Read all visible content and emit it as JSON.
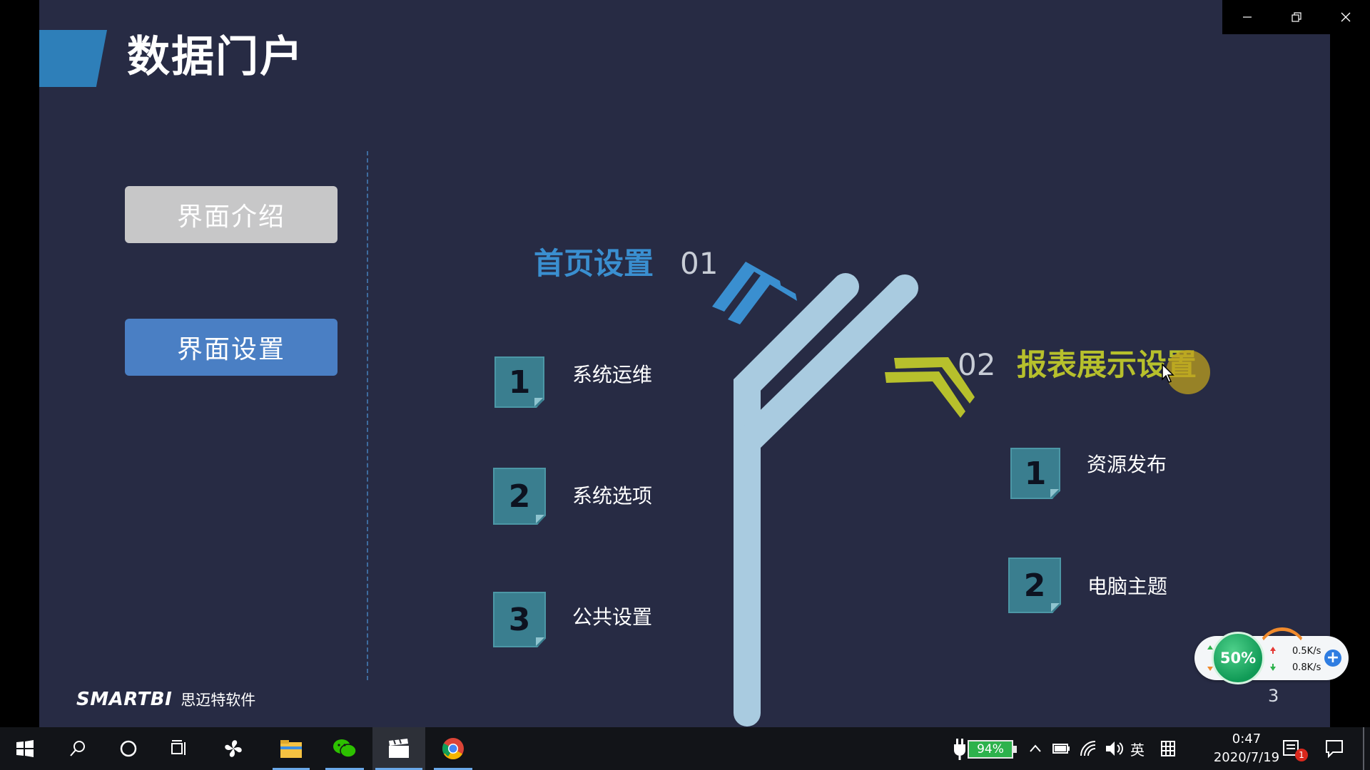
{
  "slide": {
    "title": "数据门户",
    "left_buttons": {
      "intro": "界面介绍",
      "settings": "界面设置"
    },
    "branch1": {
      "title": "首页设置",
      "number": "01",
      "color": "#3a8fd0",
      "items": [
        {
          "num": "1",
          "label": "系统运维"
        },
        {
          "num": "2",
          "label": "系统选项"
        },
        {
          "num": "3",
          "label": "公共设置"
        }
      ]
    },
    "branch2": {
      "title": "报表展示设置",
      "number": "02",
      "color": "#b7c02c",
      "items": [
        {
          "num": "1",
          "label": "资源发布"
        },
        {
          "num": "2",
          "label": "电脑主题"
        }
      ]
    },
    "brand": {
      "logo": "SMARTBI",
      "name": "思迈特软件"
    },
    "page_number": "3"
  },
  "net_widget": {
    "percent": "50%",
    "up_speed": "0.5K/s",
    "down_speed": "0.8K/s"
  },
  "taskbar": {
    "battery": "94%",
    "ime": "英",
    "time": "0:47",
    "date": "2020/7/19",
    "notification_count": "1"
  },
  "colors": {
    "slide_bg": "#272b44",
    "accent_blue": "#2e7fb9",
    "button_blue": "#4a7fc4",
    "button_gray": "#c7c7c8",
    "tree_trunk": "#a9cbe0",
    "note_teal": "#3a7e8f"
  }
}
